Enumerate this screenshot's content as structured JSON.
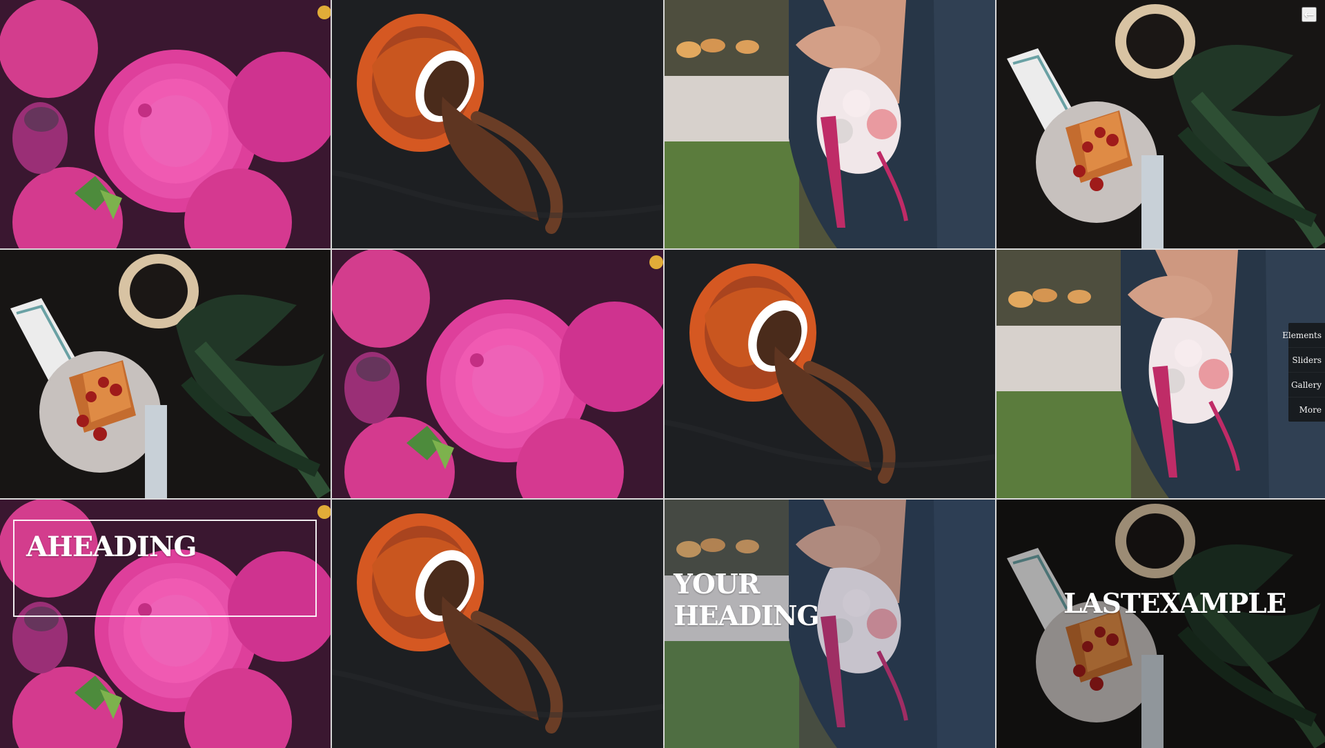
{
  "headings": {
    "tile_1": "AHEADING",
    "tile_2": "YOUR HEADING",
    "tile_3": "LASTEXAMPLE"
  },
  "controls": {
    "back_icon": "←"
  },
  "side_menu": {
    "items": [
      "Elements",
      "Sliders",
      "Gallery",
      "More"
    ]
  }
}
